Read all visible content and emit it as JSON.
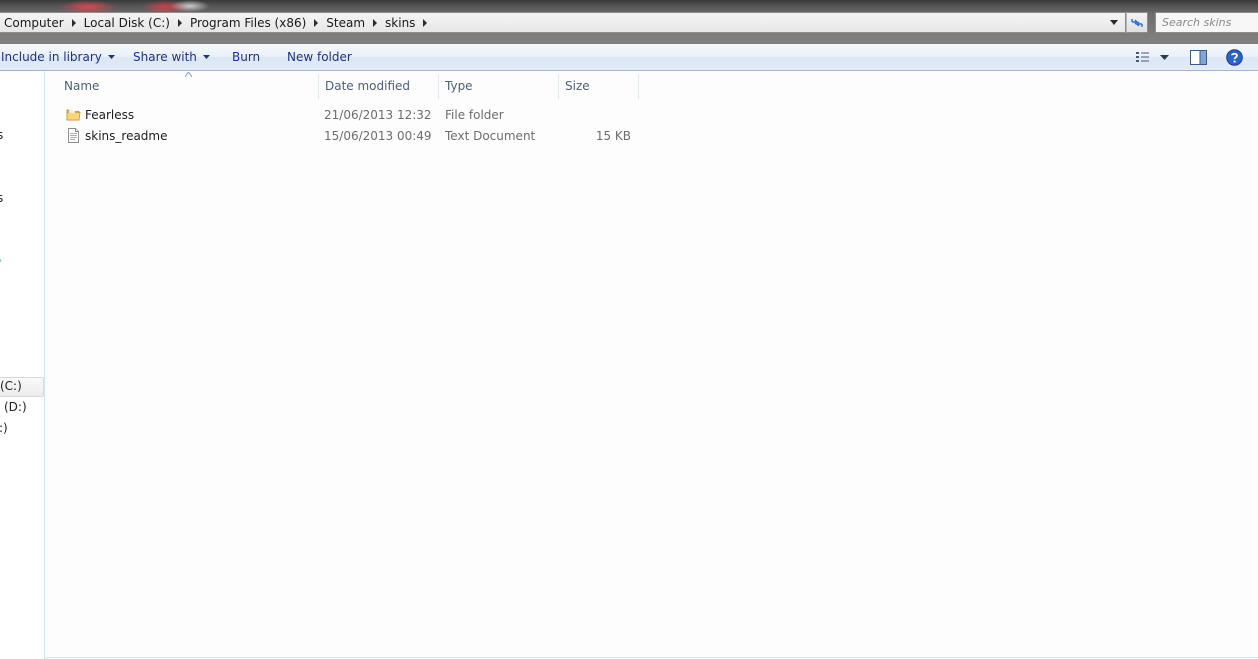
{
  "address_bar": {
    "breadcrumbs": [
      "Computer",
      "Local Disk (C:)",
      "Program Files (x86)",
      "Steam",
      "skins"
    ]
  },
  "search": {
    "placeholder": "Search skins"
  },
  "command_bar": {
    "include_in_library": "Include in library",
    "share_with": "Share with",
    "burn": "Burn",
    "new_folder": "New folder"
  },
  "nav_pane": {
    "items": [
      "s",
      "s",
      "(C:)",
      "(D:)",
      ":)"
    ]
  },
  "columns": {
    "name": "Name",
    "date_modified": "Date modified",
    "type": "Type",
    "size": "Size"
  },
  "files": [
    {
      "name": "Fearless",
      "date": "21/06/2013 12:32",
      "type": "File folder",
      "size": "",
      "icon": "folder-icon"
    },
    {
      "name": "skins_readme",
      "date": "15/06/2013 00:49",
      "type": "Text Document",
      "size": "15 KB",
      "icon": "text-document-icon"
    }
  ],
  "colors": {
    "command_text": "#1e3287",
    "header_text": "#4c607a",
    "detail_text": "#6d6d6d"
  }
}
